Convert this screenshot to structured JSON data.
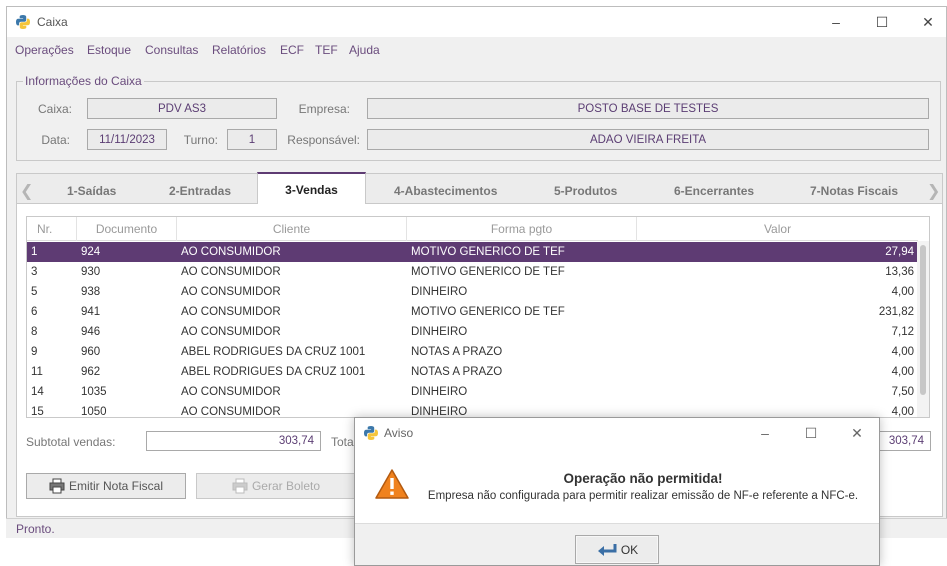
{
  "window": {
    "title": "Caixa"
  },
  "menu": [
    "Operações",
    "Estoque",
    "Consultas",
    "Relatórios",
    "ECF",
    "TEF",
    "Ajuda"
  ],
  "info": {
    "legend": "Informações do Caixa",
    "caixa_label": "Caixa:",
    "caixa": "PDV AS3",
    "empresa_label": "Empresa:",
    "empresa": "POSTO BASE DE TESTES",
    "data_label": "Data:",
    "data": "11/11/2023",
    "turno_label": "Turno:",
    "turno": "1",
    "responsavel_label": "Responsável:",
    "responsavel": "ADAO VIEIRA FREITA"
  },
  "tabs": [
    "1-Saídas",
    "2-Entradas",
    "3-Vendas",
    "4-Abastecimentos",
    "5-Produtos",
    "6-Encerrantes",
    "7-Notas Fiscais"
  ],
  "active_tab": "3-Vendas",
  "table": {
    "columns": [
      "Nr.",
      "Documento",
      "Cliente",
      "Forma pgto",
      "Valor"
    ],
    "rows": [
      [
        "1",
        "924",
        "AO CONSUMIDOR",
        "MOTIVO GENERICO DE TEF",
        "27,94"
      ],
      [
        "3",
        "930",
        "AO CONSUMIDOR",
        "MOTIVO GENERICO DE TEF",
        "13,36"
      ],
      [
        "5",
        "938",
        "AO CONSUMIDOR",
        "DINHEIRO",
        "4,00"
      ],
      [
        "6",
        "941",
        "AO CONSUMIDOR",
        "MOTIVO GENERICO DE TEF",
        "231,82"
      ],
      [
        "8",
        "946",
        "AO CONSUMIDOR",
        "DINHEIRO",
        "7,12"
      ],
      [
        "9",
        "960",
        "ABEL RODRIGUES DA CRUZ 1001",
        "NOTAS A PRAZO",
        "4,00"
      ],
      [
        "11",
        "962",
        "ABEL RODRIGUES DA CRUZ 1001",
        "NOTAS A PRAZO",
        "4,00"
      ],
      [
        "14",
        "1035",
        "AO CONSUMIDOR",
        "DINHEIRO",
        "7,50"
      ],
      [
        "15",
        "1050",
        "AO CONSUMIDOR",
        "DINHEIRO",
        "4,00"
      ]
    ]
  },
  "subtotal": {
    "label": "Subtotal vendas:",
    "value": "303,74",
    "total_label": "Total",
    "total_value": "303,74"
  },
  "buttons": {
    "emitir": "Emitir Nota Fiscal",
    "boleto": "Gerar Boleto"
  },
  "status": "Pronto.",
  "dialog": {
    "title": "Aviso",
    "heading": "Operação não permitida!",
    "message": "Empresa não configurada para permitir realizar emissão de NF-e referente a NFC-e.",
    "ok": "OK"
  },
  "colors": {
    "accent": "#5e3b73",
    "text_accent": "#6a4c7d"
  }
}
